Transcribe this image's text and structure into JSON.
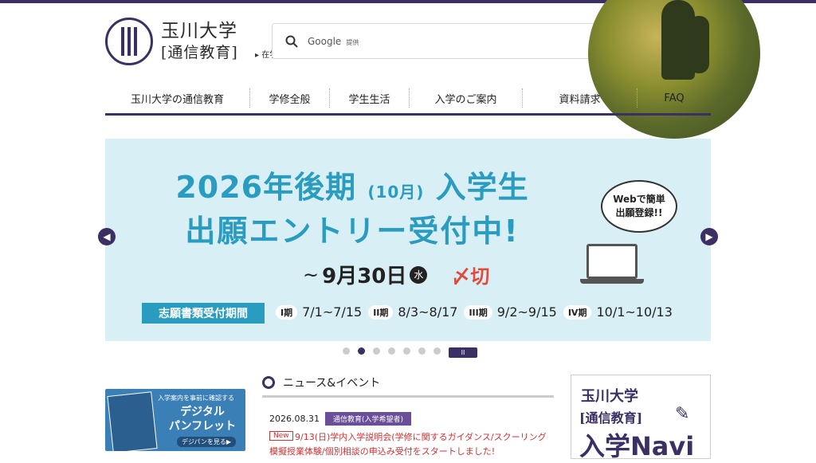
{
  "site": {
    "logo_line1": "玉川大学",
    "logo_line2": "[通信教育]",
    "current_student_link": "在学生の方"
  },
  "search": {
    "brand": "Google",
    "provided_by": "提供"
  },
  "nav": {
    "items": [
      {
        "label": "玉川大学の通信教育"
      },
      {
        "label": "学修全般"
      },
      {
        "label": "学生生活"
      },
      {
        "label": "入学のご案内"
      },
      {
        "label": "資料請求"
      },
      {
        "label": "FAQ"
      }
    ]
  },
  "banner": {
    "year_term": "2026年後期",
    "month": "(10月)",
    "admit": "入学生",
    "headline2": "出願エントリー受付中!",
    "deadline_tilde": "~",
    "deadline_date": "9月30日",
    "deadline_weekday": "水",
    "deadline_cut": "〆切",
    "bubble": "Webで簡単\n出願登録!!",
    "period_label": "志願書類受付期間",
    "periods": [
      {
        "tag": "I期",
        "dates": "7/1~7/15"
      },
      {
        "tag": "II期",
        "dates": "8/3~8/17"
      },
      {
        "tag": "III期",
        "dates": "9/2~9/15"
      },
      {
        "tag": "IV期",
        "dates": "10/1~10/13"
      }
    ]
  },
  "carousel": {
    "prev_icon": "chevron-left",
    "next_icon": "chevron-right",
    "pause_label": "II",
    "slide_count": 7,
    "active_slide": 2
  },
  "pamphlet": {
    "top_text": "入学案内を事前に確認する",
    "title_line1": "デジタル",
    "title_line2": "パンフレット",
    "button": "デジパンを見る▶"
  },
  "news": {
    "section_title": "ニュース&イベント",
    "items": [
      {
        "date": "2026.08.31",
        "category": "通信教育(入学希望者)",
        "badge": "New",
        "text": "9/13(日)学内入学説明会(学修に関するガイダンス/スクーリング模擬授業体験/個別相談の申込み受付をスタートしました!"
      }
    ]
  },
  "navi": {
    "line1": "玉川大学",
    "line2": "[通信教育]",
    "line3": "入学Navi"
  },
  "colors": {
    "brand": "#3b2f63",
    "banner_bg": "#d9eff6",
    "banner_text": "#2a9cc0",
    "accent_red": "#e04a3a"
  }
}
